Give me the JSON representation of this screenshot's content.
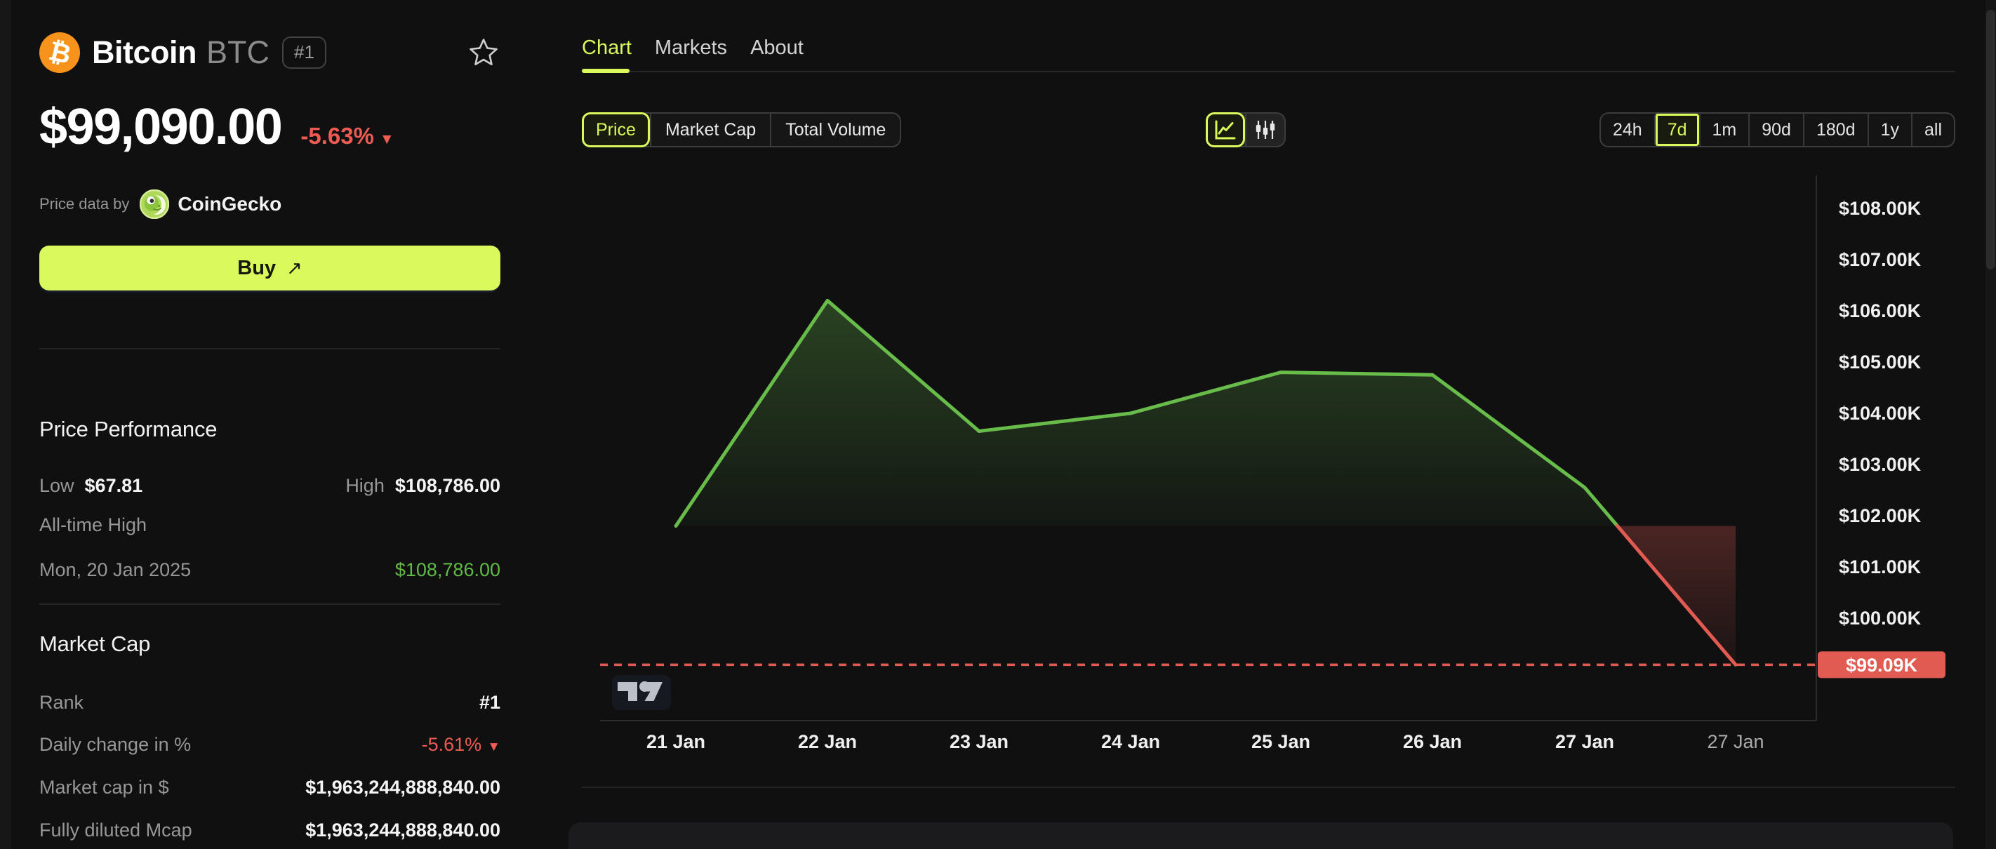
{
  "brand": {
    "accent": "#D9F95C",
    "green": "#68BC4A",
    "red": "#E25B52"
  },
  "coin_header": {
    "name": "Bitcoin",
    "symbol": "BTC",
    "rank_badge": "#1"
  },
  "price_header": {
    "price": "$99,090.00",
    "change_pct": "-5.63%",
    "down_arrow": "▼"
  },
  "attribution": {
    "prefix": "Price data by",
    "source": "CoinGecko"
  },
  "buy": {
    "label": "Buy",
    "arrow": "↗"
  },
  "price_performance": {
    "title": "Price Performance",
    "low_label": "Low",
    "low_value": "$67.81",
    "high_label": "High",
    "high_value": "$108,786.00",
    "ath_label": "All-time High",
    "ath_date": "Mon, 20 Jan 2025",
    "ath_value": "$108,786.00"
  },
  "market_cap": {
    "title": "Market Cap",
    "rows": [
      {
        "label": "Rank",
        "value": "#1",
        "style": "plain"
      },
      {
        "label": "Daily change in %",
        "value": "-5.61%",
        "arrow": "▼",
        "style": "negative"
      },
      {
        "label": "Market cap in $",
        "value": "$1,963,244,888,840.00",
        "style": "plain"
      },
      {
        "label": "Fully diluted Mcap",
        "value": "$1,963,244,888,840.00",
        "style": "plain"
      }
    ]
  },
  "tabs": {
    "items": [
      {
        "label": "Chart",
        "active": true
      },
      {
        "label": "Markets",
        "active": false
      },
      {
        "label": "About",
        "active": false
      }
    ]
  },
  "metric_switch": {
    "options": [
      {
        "label": "Price",
        "active": true
      },
      {
        "label": "Market Cap",
        "active": false
      },
      {
        "label": "Total Volume",
        "active": false
      }
    ]
  },
  "chart_type_switch": {
    "active": "line",
    "icons": [
      "line-chart-icon",
      "candlestick-icon"
    ]
  },
  "range_switch": {
    "active": "7d",
    "options": [
      {
        "label": "24h",
        "active": false
      },
      {
        "label": "7d",
        "active": true
      },
      {
        "label": "1m",
        "active": false
      },
      {
        "label": "90d",
        "active": false
      },
      {
        "label": "180d",
        "active": false
      },
      {
        "label": "1y",
        "active": false
      },
      {
        "label": "all",
        "active": false
      }
    ]
  },
  "chart_data": {
    "type": "area",
    "title": "",
    "x_labels": [
      "21 Jan",
      "22 Jan",
      "23 Jan",
      "24 Jan",
      "25 Jan",
      "26 Jan",
      "27 Jan",
      "27 Jan"
    ],
    "values_k_usd": [
      101.8,
      106.2,
      103.65,
      104.0,
      104.8,
      104.75,
      102.55,
      99.09
    ],
    "baseline_k_usd": 101.8,
    "current_price_k": 99.09,
    "current_price_label": "$99.09K",
    "y_ticks": [
      {
        "value": 108,
        "label": "$108.00K"
      },
      {
        "value": 107,
        "label": "$107.00K"
      },
      {
        "value": 106,
        "label": "$106.00K"
      },
      {
        "value": 105,
        "label": "$105.00K"
      },
      {
        "value": 104,
        "label": "$104.00K"
      },
      {
        "value": 103,
        "label": "$103.00K"
      },
      {
        "value": 102,
        "label": "$102.00K"
      },
      {
        "value": 101,
        "label": "$101.00K"
      },
      {
        "value": 100,
        "label": "$100.00K"
      }
    ],
    "ylim_k": [
      98.8,
      108.6
    ],
    "grid": false,
    "legend": "none",
    "colors": {
      "up": "#68BC4A",
      "down": "#E25B52"
    },
    "watermark": "TradingView"
  }
}
